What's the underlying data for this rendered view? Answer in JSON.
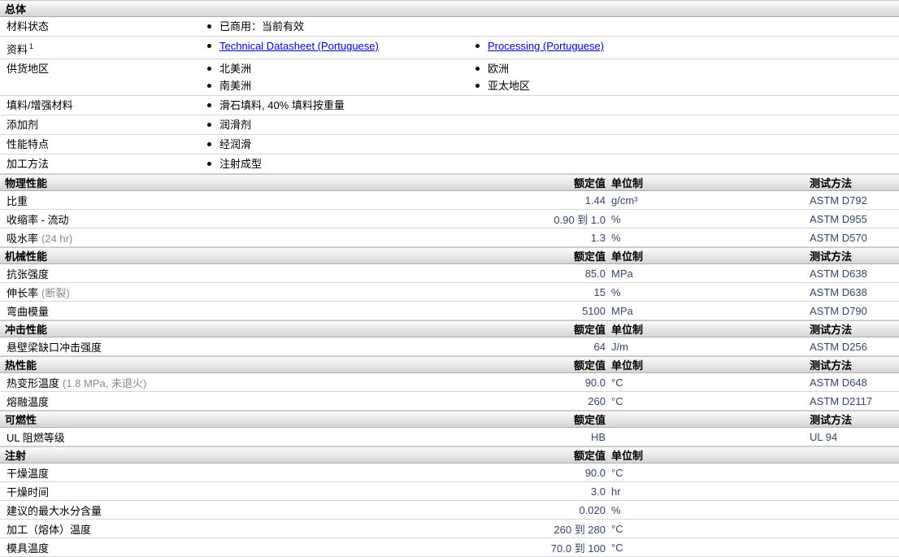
{
  "colors": {
    "value_text": "#35466B",
    "link": "#0000CC",
    "cond_text": "#8A8A8A"
  },
  "general": {
    "title": "总体",
    "rows": {
      "status": {
        "label": "材料状态",
        "item": "已商用：当前有效"
      },
      "docs": {
        "label": "资料",
        "sup": "1",
        "link1": "Technical Datasheet (Portuguese)",
        "link2": "Processing (Portuguese)"
      },
      "regions": {
        "label": "供货地区",
        "col1": [
          "北美洲",
          "南美洲"
        ],
        "col2": [
          "欧洲",
          "亚太地区"
        ]
      },
      "filler": {
        "label": "填料/增强材料",
        "item": "滑石填料, 40% 填料按重量"
      },
      "additive": {
        "label": "添加剂",
        "item": "润滑剂"
      },
      "features": {
        "label": "性能特点",
        "item": "经润滑"
      },
      "processing": {
        "label": "加工方法",
        "item": "注射成型"
      }
    }
  },
  "sections": [
    {
      "title": "物理性能",
      "headers": {
        "value": "额定值",
        "unit": "单位制",
        "method": "测试方法"
      },
      "rows": [
        {
          "label": "比重",
          "cond": "",
          "value": "1.44",
          "unit": "g/cm³",
          "method": "ASTM D792"
        },
        {
          "label": "收缩率 - 流动",
          "cond": "",
          "value": "0.90 到 1.0",
          "unit": "%",
          "method": "ASTM D955"
        },
        {
          "label": "吸水率",
          "cond": "(24 hr)",
          "value": "1.3",
          "unit": "%",
          "method": "ASTM D570"
        }
      ]
    },
    {
      "title": "机械性能",
      "headers": {
        "value": "额定值",
        "unit": "单位制",
        "method": "测试方法"
      },
      "rows": [
        {
          "label": "抗张强度",
          "cond": "",
          "value": "85.0",
          "unit": "MPa",
          "method": "ASTM D638"
        },
        {
          "label": "伸长率",
          "cond": "(断裂)",
          "value": "15",
          "unit": "%",
          "method": "ASTM D638"
        },
        {
          "label": "弯曲模量",
          "cond": "",
          "value": "5100",
          "unit": "MPa",
          "method": "ASTM D790"
        }
      ]
    },
    {
      "title": "冲击性能",
      "headers": {
        "value": "额定值",
        "unit": "单位制",
        "method": "测试方法"
      },
      "rows": [
        {
          "label": "悬壁梁缺口冲击强度",
          "cond": "",
          "value": "64",
          "unit": "J/m",
          "method": "ASTM D256"
        }
      ]
    },
    {
      "title": "热性能",
      "headers": {
        "value": "额定值",
        "unit": "单位制",
        "method": "测试方法"
      },
      "rows": [
        {
          "label": "热变形温度",
          "cond": "(1.8 MPa, 未退火)",
          "value": "90.0",
          "unit": "°C",
          "method": "ASTM D648"
        },
        {
          "label": "熔融温度",
          "cond": "",
          "value": "260",
          "unit": "°C",
          "method": "ASTM D2117"
        }
      ]
    },
    {
      "title": "可燃性",
      "headers": {
        "value": "额定值",
        "unit": "",
        "method": "测试方法"
      },
      "rows": [
        {
          "label": "UL 阻燃等级",
          "cond": "",
          "value": "HB",
          "unit": "",
          "method": "UL 94"
        }
      ]
    },
    {
      "title": "注射",
      "headers": {
        "value": "额定值",
        "unit": "单位制",
        "method": ""
      },
      "rows": [
        {
          "label": "干燥温度",
          "cond": "",
          "value": "90.0",
          "unit": "°C",
          "method": ""
        },
        {
          "label": "干燥时间",
          "cond": "",
          "value": "3.0",
          "unit": "hr",
          "method": ""
        },
        {
          "label": "建议的最大水分含量",
          "cond": "",
          "value": "0.020",
          "unit": "%",
          "method": ""
        },
        {
          "label": "加工（熔体）温度",
          "cond": "",
          "value": "260 到 280",
          "unit": "°C",
          "method": ""
        },
        {
          "label": "模具温度",
          "cond": "",
          "value": "70.0 到 100",
          "unit": "°C",
          "method": ""
        }
      ]
    }
  ]
}
